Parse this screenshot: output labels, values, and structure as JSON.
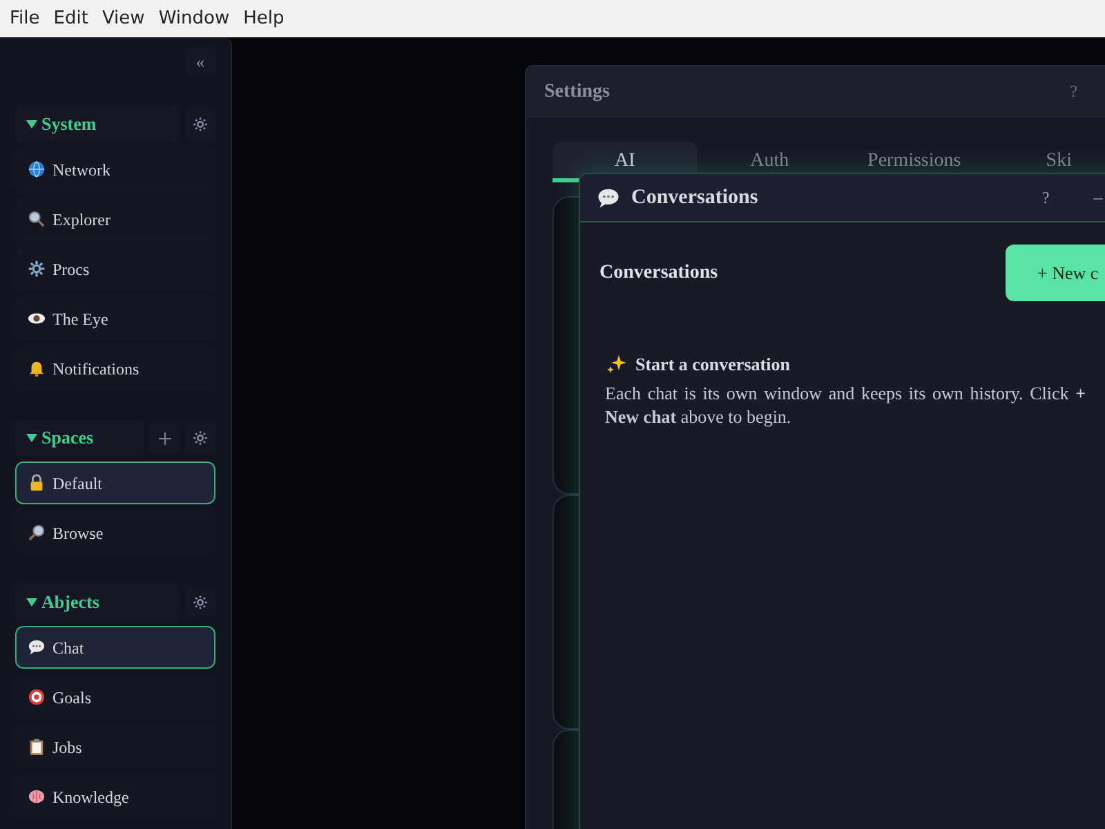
{
  "menu_bar": [
    "File",
    "Edit",
    "View",
    "Window",
    "Help"
  ],
  "sidebar": {
    "collapse": "«",
    "sections": [
      {
        "title": "System",
        "expanded": true,
        "add": false,
        "items": [
          {
            "label": "Network",
            "selected": false
          },
          {
            "label": "Explorer",
            "selected": false
          },
          {
            "label": "Procs",
            "selected": false
          },
          {
            "label": "The Eye",
            "selected": false
          },
          {
            "label": "Notifications",
            "selected": false
          }
        ]
      },
      {
        "title": "Spaces",
        "expanded": true,
        "add": true,
        "items": [
          {
            "label": "Default",
            "selected": true
          },
          {
            "label": "Browse",
            "selected": false
          }
        ]
      },
      {
        "title": "Abjects",
        "expanded": true,
        "add": false,
        "items": [
          {
            "label": "Chat",
            "selected": true
          },
          {
            "label": "Goals",
            "selected": false
          },
          {
            "label": "Jobs",
            "selected": false
          },
          {
            "label": "Knowledge",
            "selected": false
          }
        ]
      }
    ]
  },
  "settings_window": {
    "title": "Settings",
    "help": "?",
    "tabs": [
      {
        "label": "AI",
        "selected": true
      },
      {
        "label": "Auth",
        "selected": false
      },
      {
        "label": "Permissions",
        "selected": false
      },
      {
        "label": "Ski",
        "selected": false
      }
    ]
  },
  "conversations_window": {
    "title": "Conversations",
    "help": "?",
    "minimize": "–",
    "heading": "Conversations",
    "new_button": "+ New c",
    "empty_title": "Start a conversation",
    "empty_text": "Each chat is its own window and keeps its own history. Click **+ New chat** above to begin."
  }
}
